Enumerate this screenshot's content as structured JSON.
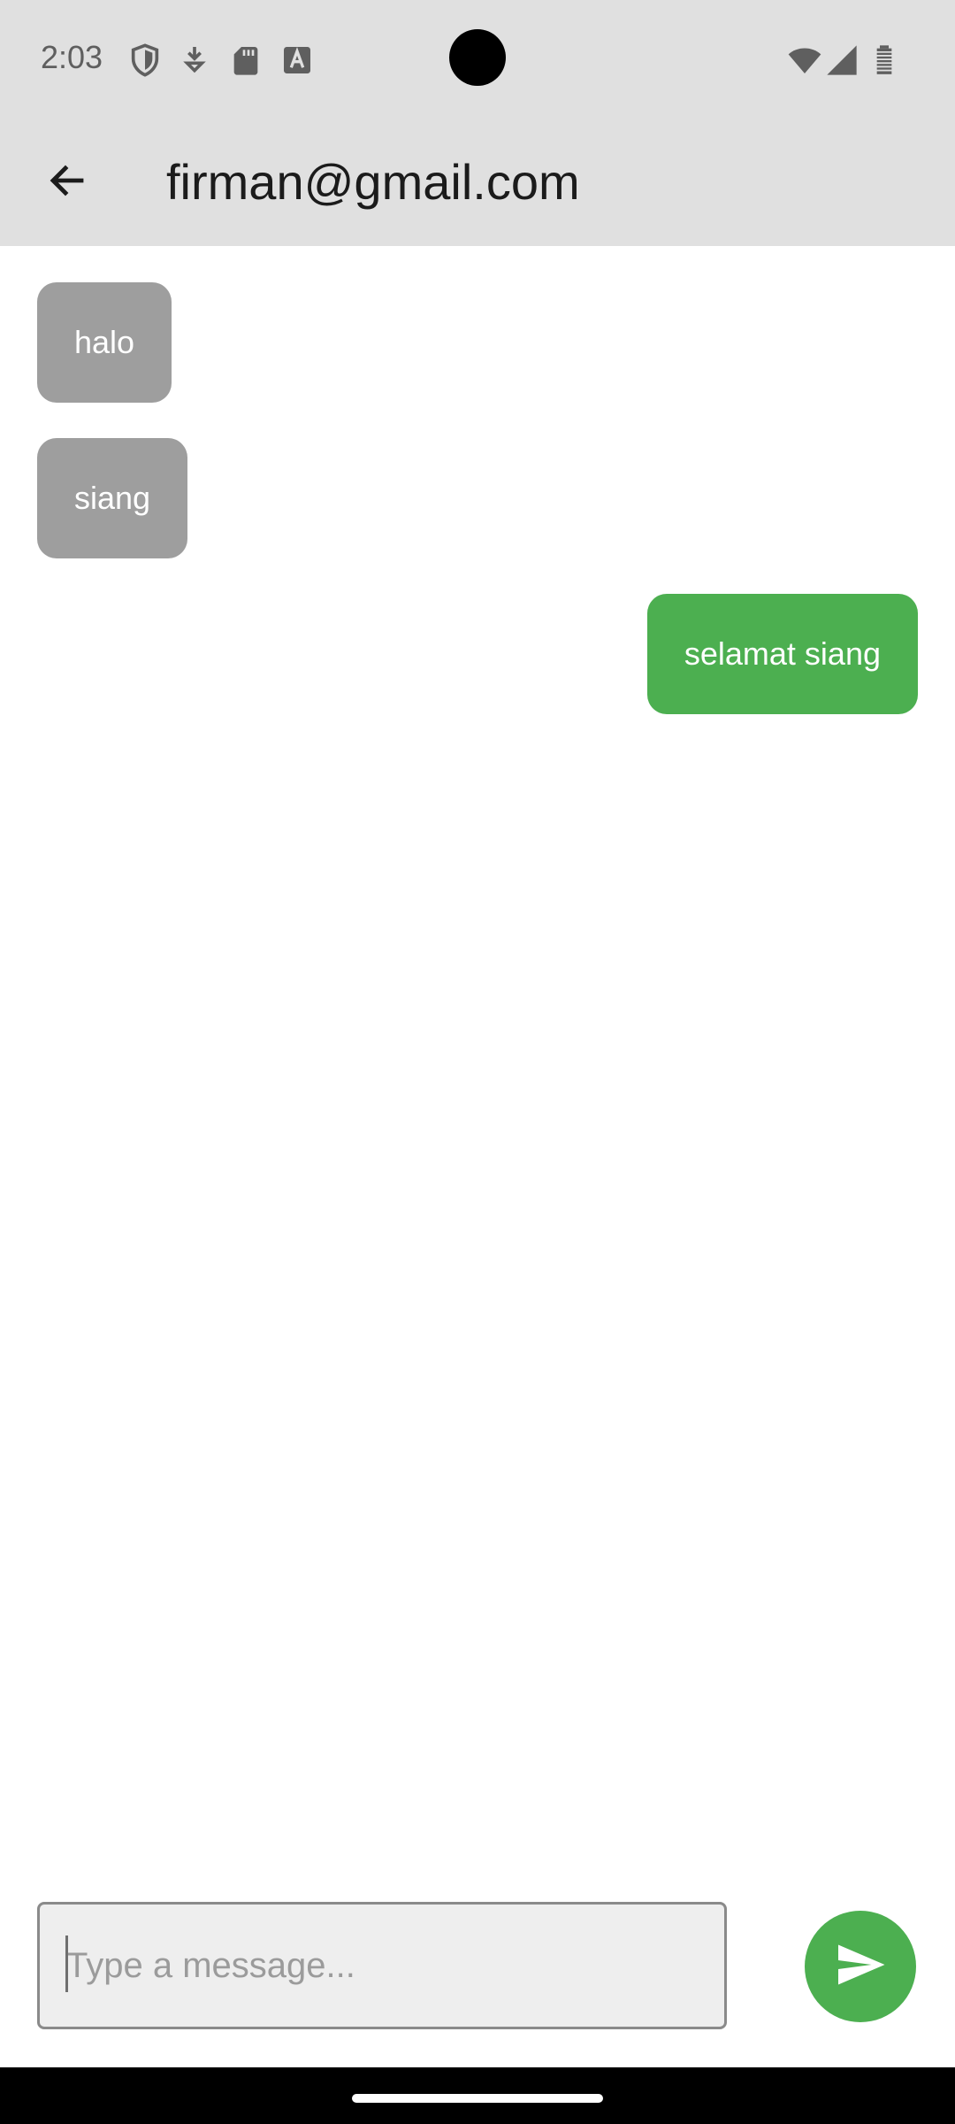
{
  "status_bar": {
    "time": "2:03",
    "left_icons": [
      "shield-icon",
      "download-icon",
      "sd-card-icon",
      "text-a-icon"
    ],
    "right_icons": [
      "wifi-icon",
      "cell-signal-icon",
      "battery-icon"
    ]
  },
  "app_bar": {
    "back_icon": "arrow-back-icon",
    "title": "firman@gmail.com"
  },
  "messages": [
    {
      "text": "halo",
      "direction": "received"
    },
    {
      "text": "siang",
      "direction": "received"
    },
    {
      "text": "selamat siang",
      "direction": "sent"
    }
  ],
  "composer": {
    "placeholder": "Type a message...",
    "value": "",
    "send_icon": "send-icon"
  },
  "colors": {
    "app_bar_bg": "#e0e0e0",
    "received_bubble": "#9e9e9e",
    "sent_bubble": "#4caf50",
    "send_button": "#4caf50"
  }
}
